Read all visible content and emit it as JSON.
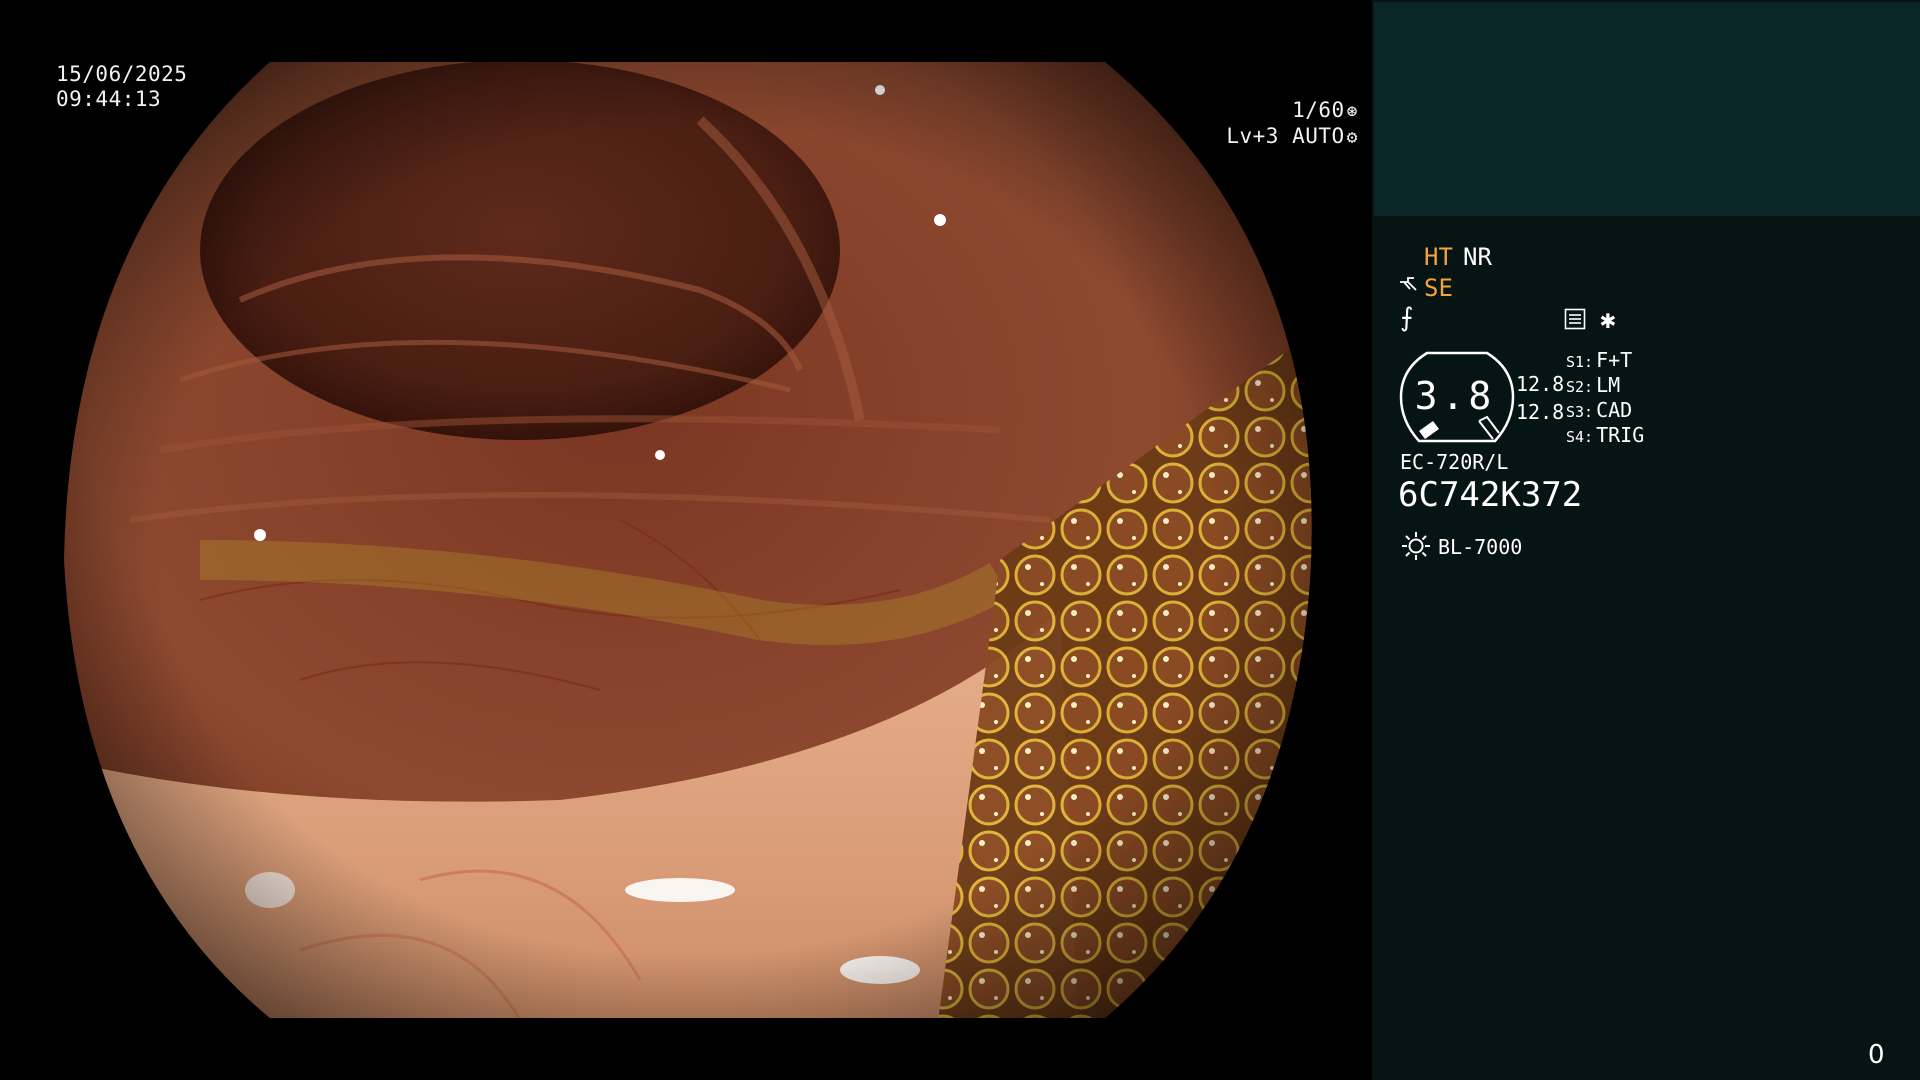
{
  "scope_view": {
    "date": "15/06/2025",
    "time": "09:44:13",
    "shutter": "1/60",
    "shutter_icon": "aperture-icon",
    "iris": "Lv+3",
    "iris_mode": "AUTO",
    "iris_icon": "gear-icon"
  },
  "panel": {
    "ht_label": "HT",
    "nr_label": "NR",
    "se_icon": "structure-enhance-icon",
    "se_label": "SE",
    "fx_icon": "color-enhance-icon",
    "fx_glyph": "⨍",
    "menu_icon": "menu-list-icon",
    "star_icon": "star-icon",
    "star_glyph": "✱",
    "zoom": {
      "value": "3.8",
      "readout_1": "12.8",
      "readout_2": "12.8"
    },
    "switches": [
      {
        "key": "S1:",
        "value": "F+T"
      },
      {
        "key": "S2:",
        "value": "LM"
      },
      {
        "key": "S3:",
        "value": "CAD"
      },
      {
        "key": "S4:",
        "value": "TRIG"
      }
    ],
    "scope_model": "EC-720R/L",
    "serial_number": "6C742K372",
    "light_icon": "sun-icon",
    "light_source": "BL-7000"
  },
  "colors": {
    "accent_orange": "#f2a33a",
    "panel_bg": "#071414",
    "panel_top_bg": "#0b2626"
  },
  "counter": "0"
}
